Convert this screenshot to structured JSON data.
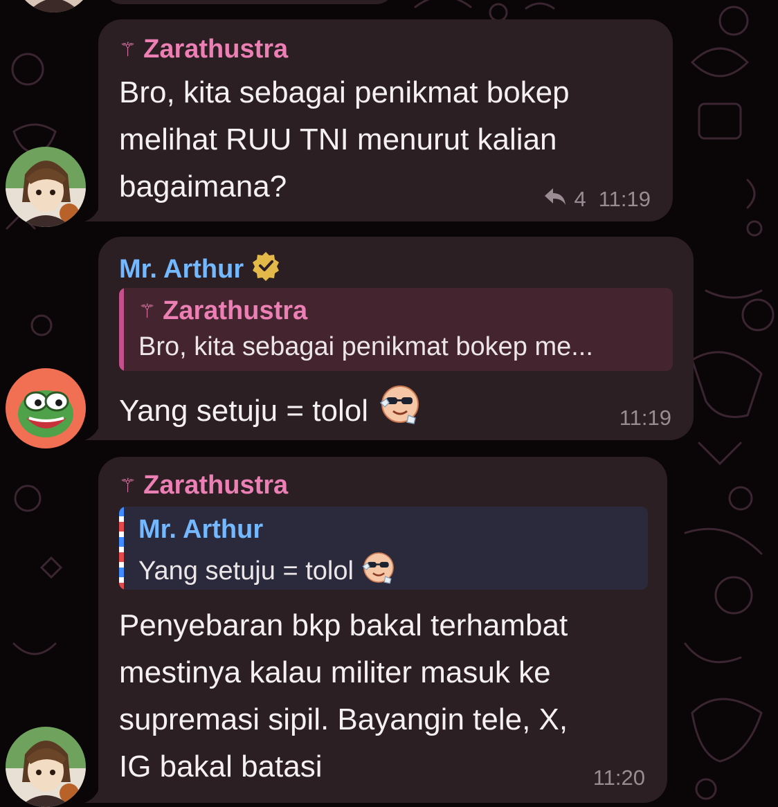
{
  "messages": [
    {
      "sender": "Zarathustra",
      "sender_icon": "caduceus-icon",
      "lines": [
        "Bro, kita sebagai penikmat bokep",
        "melihat RUU TNI menurut kalian",
        "bagaimana?"
      ],
      "reply_count": "4",
      "time": "11:19"
    },
    {
      "sender": "Mr. Arthur",
      "sender_badge": "verified-badge-icon",
      "quote": {
        "sender": "Zarathustra",
        "text": "Bro, kita sebagai penikmat bokep me..."
      },
      "text": "Yang setuju = tolol",
      "emoji": "cool-sunglasses-emoji",
      "time": "11:19"
    },
    {
      "sender": "Zarathustra",
      "sender_icon": "caduceus-icon",
      "quote": {
        "sender": "Mr. Arthur",
        "text": "Yang setuju = tolol",
        "emoji": "cool-sunglasses-emoji"
      },
      "lines": [
        "Penyebaran bkp bakal terhambat",
        "mestinya kalau militer masuk ke",
        "supremasi sipil. Bayangin tele, X,",
        "IG bakal batasi"
      ],
      "time": "11:20"
    }
  ],
  "colors": {
    "bubble": "#2c1f23",
    "pink_name": "#ec7fb3",
    "blue_name": "#74b8ff",
    "badge_gold": "#e3b94a"
  }
}
